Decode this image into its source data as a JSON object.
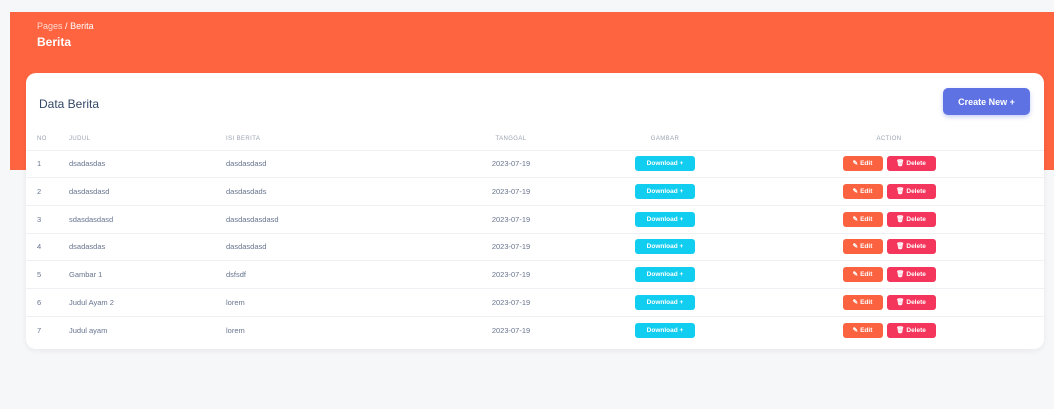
{
  "breadcrumb": {
    "parent": "Pages",
    "separator": "/",
    "current": "Berita"
  },
  "page_title": "Berita",
  "card": {
    "title": "Data Berita",
    "create_label": "Create New +"
  },
  "table": {
    "headers": [
      "NO",
      "JUDUL",
      "ISI BERITA",
      "TANGGAL",
      "GAMBAR",
      "ACTION"
    ],
    "rows": [
      {
        "no": "1",
        "judul": "dsadasdas",
        "isi": "dasdasdasd",
        "tanggal": "2023-07-19"
      },
      {
        "no": "2",
        "judul": "dasdasdasd",
        "isi": "dasdasdads",
        "tanggal": "2023-07-19"
      },
      {
        "no": "3",
        "judul": "sdasdasdasd",
        "isi": "dasdasdasdasd",
        "tanggal": "2023-07-19"
      },
      {
        "no": "4",
        "judul": "dsadasdas",
        "isi": "dasdasdasd",
        "tanggal": "2023-07-19"
      },
      {
        "no": "5",
        "judul": "Gambar 1",
        "isi": "dsfsdf",
        "tanggal": "2023-07-19"
      },
      {
        "no": "6",
        "judul": "Judul Ayam 2",
        "isi": "lorem",
        "tanggal": "2023-07-19"
      },
      {
        "no": "7",
        "judul": "Judul ayam",
        "isi": "lorem",
        "tanggal": "2023-07-19"
      }
    ],
    "download_label": "Download +",
    "edit_label": "Edit",
    "delete_label": "Delete",
    "edit_icon": "pencil-icon",
    "delete_icon": "trash-icon"
  },
  "colors": {
    "hero": "#ff6441",
    "primary": "#5e72e4",
    "info": "#11cdef",
    "warning": "#fb6340",
    "danger": "#f5365c"
  }
}
